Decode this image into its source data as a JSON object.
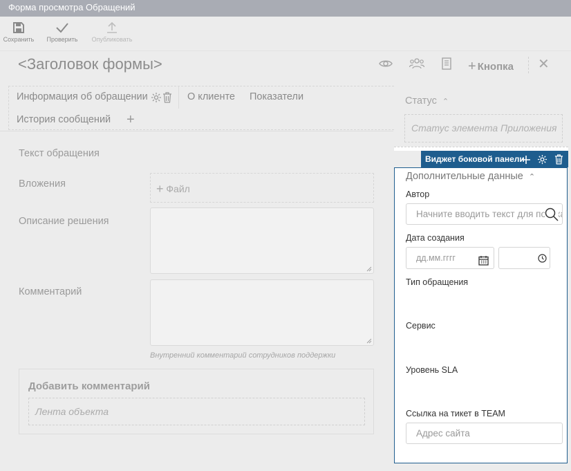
{
  "window": {
    "title": "Форма просмотра Обращений"
  },
  "toolbar": {
    "save_label": "Сохранить",
    "check_label": "Проверить",
    "publish_label": "Опубликовать"
  },
  "header": {
    "form_title": "<Заголовок формы>",
    "add_button_label": "Кнопка"
  },
  "tabs": [
    {
      "label": "Информация об обращении"
    },
    {
      "label": "О клиенте"
    },
    {
      "label": "Показатели"
    },
    {
      "label": "История сообщений"
    }
  ],
  "form": {
    "text_label": "Текст обращения",
    "attachments_label": "Вложения",
    "file_button_label": "Файл",
    "solution_label": "Описание решения",
    "comment_label": "Комментарий",
    "comment_hint": "Внутренний комментарий сотрудников поддержки",
    "add_comment_title": "Добавить комментарий",
    "feed_placeholder": "Лента объекта"
  },
  "status": {
    "label": "Статус",
    "placeholder": "Статус элемента Приложения"
  },
  "widget": {
    "tab_label": "Виджет боковой панели",
    "title": "Дополнительные данные",
    "author_label": "Автор",
    "author_placeholder": "Начните вводить текст для поиска",
    "created_label": "Дата создания",
    "date_placeholder": "дд.мм.гггг",
    "type_label": "Тип обращения",
    "service_label": "Сервис",
    "sla_label": "Уровень SLA",
    "team_link_label": "Ссылка на тикет в TEAM",
    "site_placeholder": "Адрес сайта"
  },
  "colors": {
    "accent": "#1e5d8e",
    "titlebar": "#a9acb4"
  }
}
